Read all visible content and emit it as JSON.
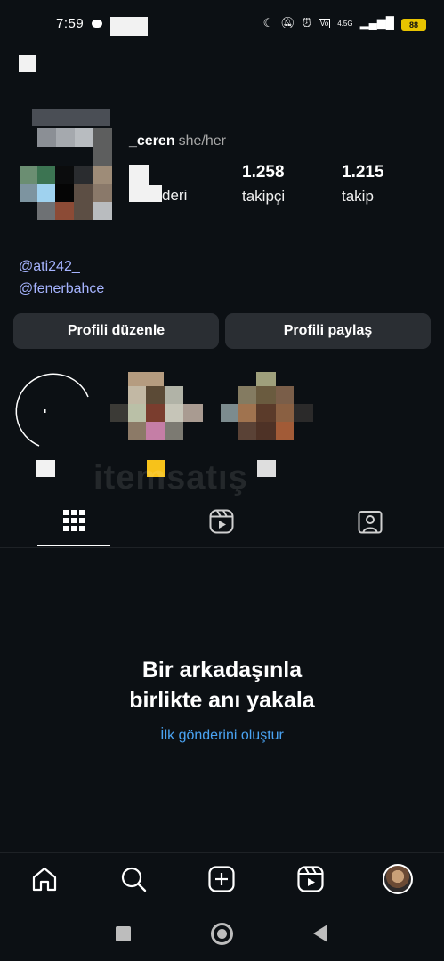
{
  "status_bar": {
    "time": "7:59",
    "network": "4.5G",
    "battery": "88"
  },
  "profile": {
    "username": "_ceren",
    "pronouns": "she/her",
    "posts_label_partial": "deri",
    "followers_count": "1.258",
    "followers_label": "takipçi",
    "following_count": "1.215",
    "following_label": "takip",
    "bio_links": [
      "@ati242_",
      "@fenerbahce"
    ]
  },
  "actions": {
    "edit_profile": "Profili düzenle",
    "share_profile": "Profili paylaş"
  },
  "watermark": "itemsatış",
  "empty_state": {
    "title_line1": "Bir arkadaşınla",
    "title_line2": "birlikte anı yakala",
    "cta": "İlk gönderini oluştur"
  },
  "tabs": [
    "grid-icon",
    "reels-icon",
    "tagged-icon"
  ],
  "bottom_nav": [
    "home-icon",
    "search-icon",
    "create-icon",
    "reels-icon",
    "profile-avatar"
  ],
  "colors": {
    "background": "#0c1014",
    "button": "#2a2e33",
    "link": "#a6b4ff",
    "cta": "#4aa3f2"
  }
}
